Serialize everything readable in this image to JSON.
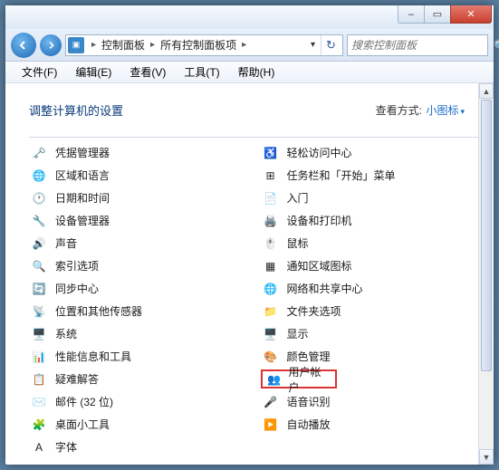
{
  "window": {
    "min_icon": "–",
    "max_icon": "▭",
    "close_icon": "✕"
  },
  "nav": {
    "address_icon": "▣",
    "sep": "▸",
    "breadcrumb": [
      "控制面板",
      "所有控制面板项"
    ],
    "dropdown_arrow": "▾",
    "refresh": "↻"
  },
  "search": {
    "placeholder": "搜索控制面板",
    "icon": "🔍"
  },
  "menu": [
    "文件(F)",
    "编辑(E)",
    "查看(V)",
    "工具(T)",
    "帮助(H)"
  ],
  "header": {
    "title": "调整计算机的设置",
    "view_label": "查看方式:",
    "view_value": "小图标",
    "view_arrow": "▾"
  },
  "left_col": [
    {
      "name": "credential-manager",
      "label": "凭据管理器",
      "icon": "🗝️"
    },
    {
      "name": "region-language",
      "label": "区域和语言",
      "icon": "🌐"
    },
    {
      "name": "date-time",
      "label": "日期和时间",
      "icon": "🕐"
    },
    {
      "name": "device-manager",
      "label": "设备管理器",
      "icon": "🔧"
    },
    {
      "name": "sound",
      "label": "声音",
      "icon": "🔊"
    },
    {
      "name": "indexing-options",
      "label": "索引选项",
      "icon": "🔍"
    },
    {
      "name": "sync-center",
      "label": "同步中心",
      "icon": "🔄"
    },
    {
      "name": "location-sensors",
      "label": "位置和其他传感器",
      "icon": "📡"
    },
    {
      "name": "system",
      "label": "系统",
      "icon": "🖥️"
    },
    {
      "name": "performance-info",
      "label": "性能信息和工具",
      "icon": "📊"
    },
    {
      "name": "troubleshooting",
      "label": "疑难解答",
      "icon": "📋"
    },
    {
      "name": "mail-32",
      "label": "邮件 (32 位)",
      "icon": "✉️"
    },
    {
      "name": "desktop-gadgets",
      "label": "桌面小工具",
      "icon": "🧩"
    },
    {
      "name": "fonts",
      "label": "字体",
      "icon": "A"
    }
  ],
  "right_col": [
    {
      "name": "ease-of-access",
      "label": "轻松访问中心",
      "icon": "♿"
    },
    {
      "name": "taskbar-start",
      "label": "任务栏和「开始」菜单",
      "icon": "⊞"
    },
    {
      "name": "getting-started",
      "label": "入门",
      "icon": "📄"
    },
    {
      "name": "devices-printers",
      "label": "设备和打印机",
      "icon": "🖨️"
    },
    {
      "name": "mouse",
      "label": "鼠标",
      "icon": "🖱️"
    },
    {
      "name": "notification-icons",
      "label": "通知区域图标",
      "icon": "▦"
    },
    {
      "name": "network-sharing",
      "label": "网络和共享中心",
      "icon": "🌐"
    },
    {
      "name": "folder-options",
      "label": "文件夹选项",
      "icon": "📁"
    },
    {
      "name": "display",
      "label": "显示",
      "icon": "🖥️"
    },
    {
      "name": "color-management",
      "label": "颜色管理",
      "icon": "🎨"
    },
    {
      "name": "user-accounts",
      "label": "用户帐户",
      "icon": "👥",
      "highlighted": true
    },
    {
      "name": "speech-recognition",
      "label": "语音识别",
      "icon": "🎤"
    },
    {
      "name": "autoplay",
      "label": "自动播放",
      "icon": "▶️"
    }
  ],
  "scrollbar": {
    "up": "▲",
    "down": "▼"
  }
}
